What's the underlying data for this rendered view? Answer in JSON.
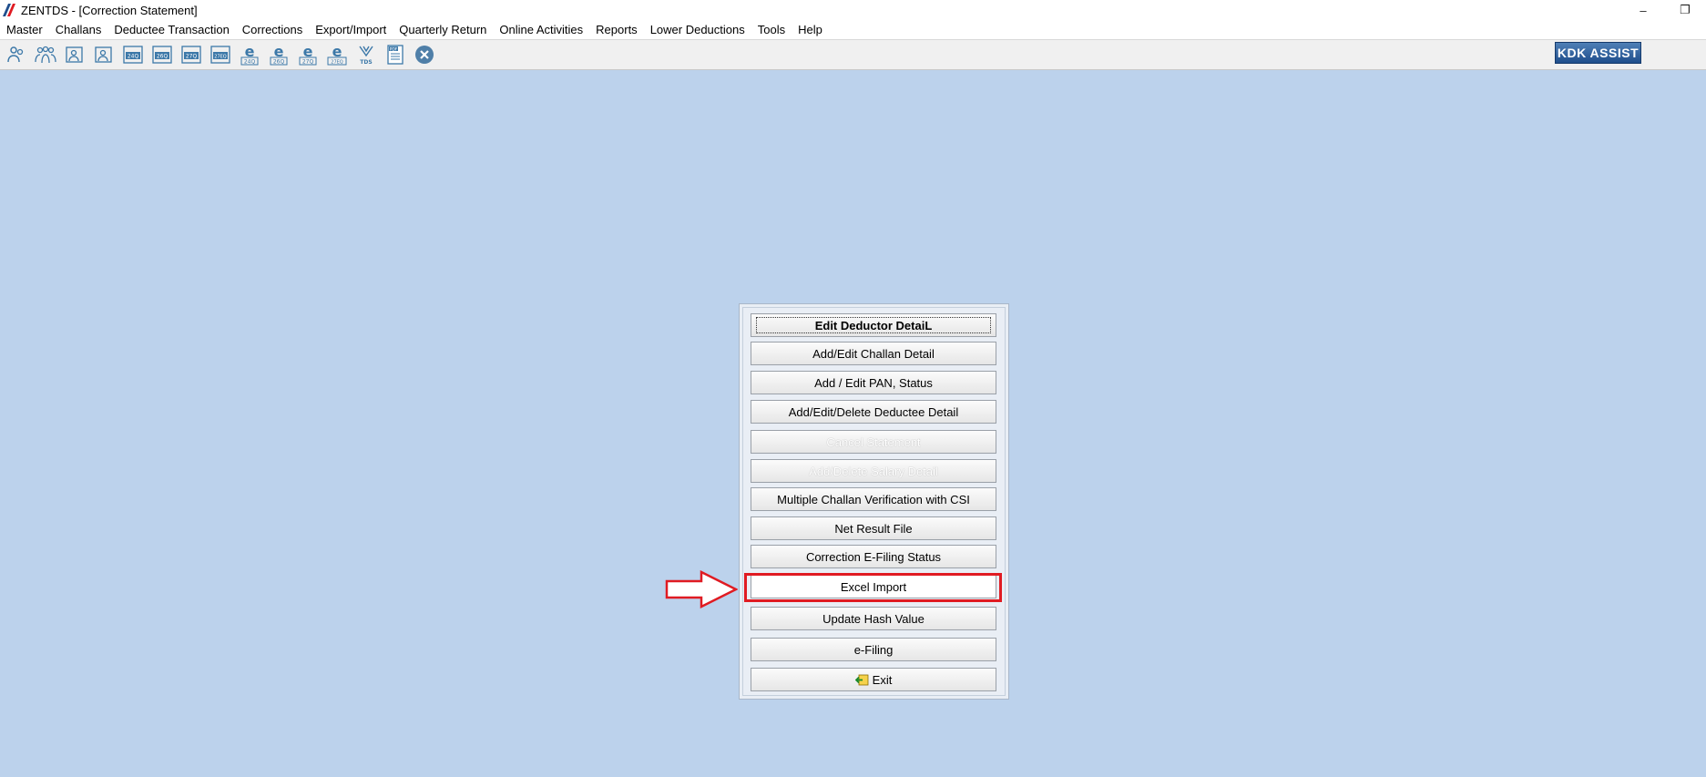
{
  "window": {
    "title": "ZENTDS - [Correction Statement]",
    "minimize_glyph": "–",
    "restore_glyph": "❐"
  },
  "menu": [
    "Master",
    "Challans",
    "Deductee Transaction",
    "Corrections",
    "Export/Import",
    "Quarterly Return",
    "Online Activities",
    "Reports",
    "Lower Deductions",
    "Tools",
    "Help"
  ],
  "toolbar": {
    "icons": [
      {
        "name": "deductor-icon"
      },
      {
        "name": "deductees-icon"
      },
      {
        "name": "employee-icon"
      },
      {
        "name": "employee-2-icon"
      },
      {
        "name": "form-24q-icon",
        "label": "24Q"
      },
      {
        "name": "form-26q-icon",
        "label": "26Q"
      },
      {
        "name": "form-27q-icon",
        "label": "27Q"
      },
      {
        "name": "form-27eq-icon",
        "label": "27EQ"
      },
      {
        "name": "efile-24q-icon",
        "label": "24Q"
      },
      {
        "name": "efile-26q-icon",
        "label": "26Q"
      },
      {
        "name": "efile-27q-icon",
        "label": "27Q"
      },
      {
        "name": "efile-27eq-icon",
        "label": "27EQ"
      },
      {
        "name": "tds-icon",
        "label": "TDS"
      },
      {
        "name": "pdf-document-icon",
        "label": "PDF"
      },
      {
        "name": "close-icon"
      }
    ],
    "kdk_assist": "KDK ASSIST"
  },
  "colors": {
    "background": "#bcd2ec",
    "highlight": "#e01b22",
    "brand": "#1f4e8c"
  },
  "panel": {
    "buttons": [
      {
        "key": "edit-deductor-detail",
        "label": "Edit Deductor DetaiL",
        "state": "focused"
      },
      {
        "key": "add-edit-challan-detail",
        "label": "Add/Edit Challan Detail",
        "state": "normal"
      },
      {
        "key": "add-edit-pan-status",
        "label": "Add / Edit PAN, Status",
        "state": "normal"
      },
      {
        "key": "add-edit-delete-deductee-detail",
        "label": "Add/Edit/Delete Deductee Detail",
        "state": "normal"
      },
      {
        "key": "cancel-statement",
        "label": "Cancel Statement",
        "state": "disabled"
      },
      {
        "key": "add-delete-salary-detail",
        "label": "Add/Delete Salary Detail",
        "state": "disabled"
      },
      {
        "key": "multiple-challan-verification",
        "label": "Multiple Challan Verification with CSI",
        "state": "normal"
      },
      {
        "key": "net-result-file",
        "label": "Net Result File",
        "state": "normal"
      },
      {
        "key": "correction-efiling-status",
        "label": "Correction E-Filing Status",
        "state": "normal"
      },
      {
        "key": "excel-import",
        "label": "Excel Import",
        "state": "highlighted"
      },
      {
        "key": "update-hash-value",
        "label": "Update Hash Value",
        "state": "normal"
      },
      {
        "key": "e-filing",
        "label": "e-Filing",
        "state": "normal"
      },
      {
        "key": "exit",
        "label": "Exit",
        "state": "normal"
      }
    ]
  }
}
